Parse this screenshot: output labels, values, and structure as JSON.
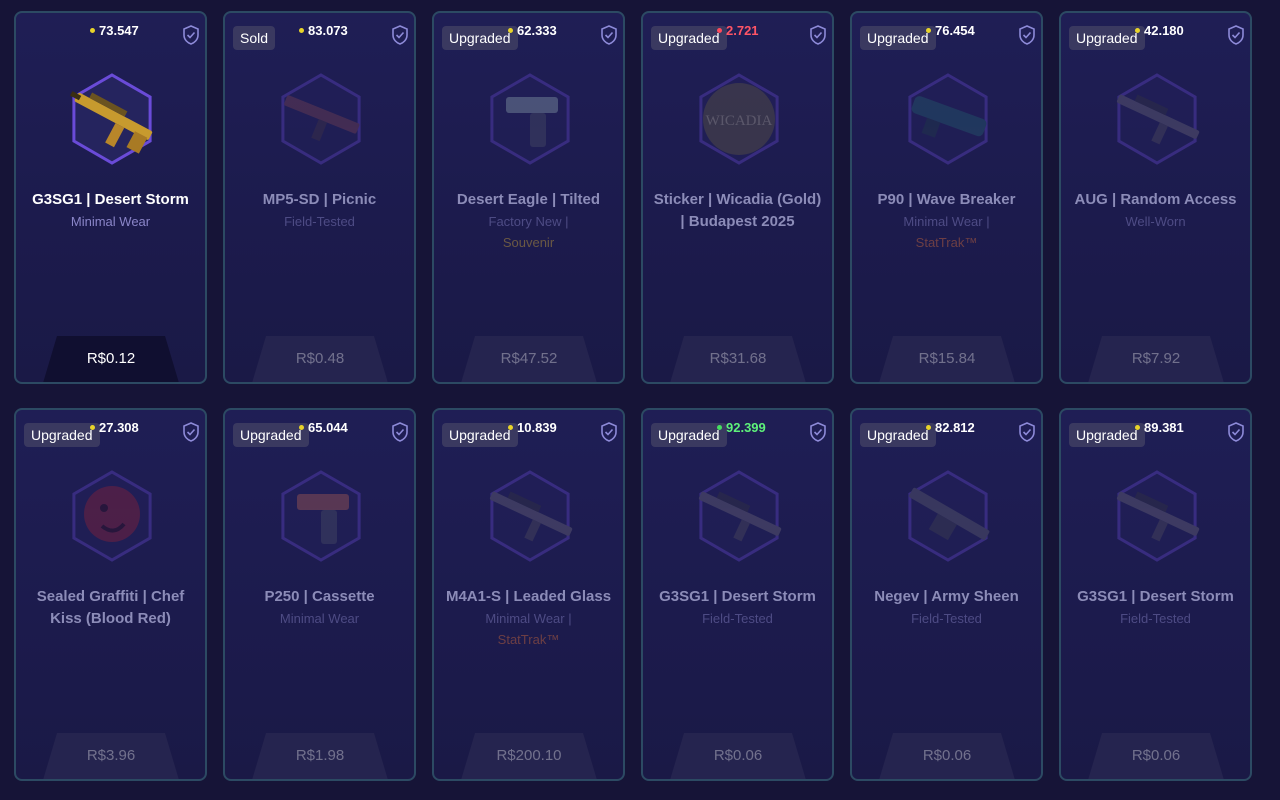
{
  "cards": [
    {
      "tag": "",
      "pct": "73.547",
      "dot": "#e8d42a",
      "title": "G3SG1 | Desert Storm",
      "line1": "Minimal Wear",
      "line2": "",
      "line2_type": "",
      "price": "R$0.12",
      "dim": false,
      "art": "rifle-gold"
    },
    {
      "tag": "Sold",
      "pct": "83.073",
      "dot": "#e8d42a",
      "title": "MP5-SD | Picnic",
      "line1": "Field-Tested",
      "line2": "",
      "line2_type": "",
      "price": "R$0.48",
      "dim": true,
      "art": "smg"
    },
    {
      "tag": "Upgraded",
      "pct": "62.333",
      "dot": "#e8d42a",
      "title": "Desert Eagle | Tilted",
      "line1": "Factory New |",
      "line2": "Souvenir",
      "line2_type": "souvenir",
      "price": "R$47.52",
      "dim": true,
      "art": "pistol"
    },
    {
      "tag": "Upgraded",
      "pct": "2.721",
      "dot": "#ff4a5c",
      "title": "Sticker | Wicadia (Gold) | Budapest 2025",
      "line1": "",
      "line2": "",
      "line2_type": "",
      "price": "R$31.68",
      "dim": true,
      "art": "sticker",
      "pct_color": "#ff5566"
    },
    {
      "tag": "Upgraded",
      "pct": "76.454",
      "dot": "#e8d42a",
      "title": "P90 | Wave Breaker",
      "line1": "Minimal Wear |",
      "line2": "StatTrak™",
      "line2_type": "stattrak",
      "price": "R$15.84",
      "dim": true,
      "art": "p90"
    },
    {
      "tag": "Upgraded",
      "pct": "42.180",
      "dot": "#e8d42a",
      "title": "AUG | Random Access",
      "line1": "Well-Worn",
      "line2": "",
      "line2_type": "",
      "price": "R$7.92",
      "dim": true,
      "art": "rifle"
    },
    {
      "tag": "Upgraded",
      "pct": "27.308",
      "dot": "#e8d42a",
      "title": "Sealed Graffiti | Chef Kiss (Blood Red)",
      "line1": "",
      "line2": "",
      "line2_type": "",
      "price": "R$3.96",
      "dim": true,
      "art": "graffiti"
    },
    {
      "tag": "Upgraded",
      "pct": "65.044",
      "dot": "#e8d42a",
      "title": "P250 | Cassette",
      "line1": "Minimal Wear",
      "line2": "",
      "line2_type": "",
      "price": "R$1.98",
      "dim": true,
      "art": "pistol2"
    },
    {
      "tag": "Upgraded",
      "pct": "10.839",
      "dot": "#e8d42a",
      "title": "M4A1-S | Leaded Glass",
      "line1": "Minimal Wear |",
      "line2": "StatTrak™",
      "line2_type": "stattrak",
      "price": "R$200.10",
      "dim": true,
      "art": "rifle"
    },
    {
      "tag": "Upgraded",
      "pct": "92.399",
      "dot": "#45e060",
      "title": "G3SG1 | Desert Storm",
      "line1": "Field-Tested",
      "line2": "",
      "line2_type": "",
      "price": "R$0.06",
      "dim": true,
      "art": "rifle",
      "pct_color": "#5ef27a"
    },
    {
      "tag": "Upgraded",
      "pct": "82.812",
      "dot": "#e8d42a",
      "title": "Negev | Army Sheen",
      "line1": "Field-Tested",
      "line2": "",
      "line2_type": "",
      "price": "R$0.06",
      "dim": true,
      "art": "lmg"
    },
    {
      "tag": "Upgraded",
      "pct": "89.381",
      "dot": "#e8d42a",
      "title": "G3SG1 | Desert Storm",
      "line1": "Field-Tested",
      "line2": "",
      "line2_type": "",
      "price": "R$0.06",
      "dim": true,
      "art": "rifle"
    }
  ],
  "colors": {
    "background": "#161437",
    "card_border": "#2c4a63",
    "rarity_purple": "#5b3fd0"
  }
}
